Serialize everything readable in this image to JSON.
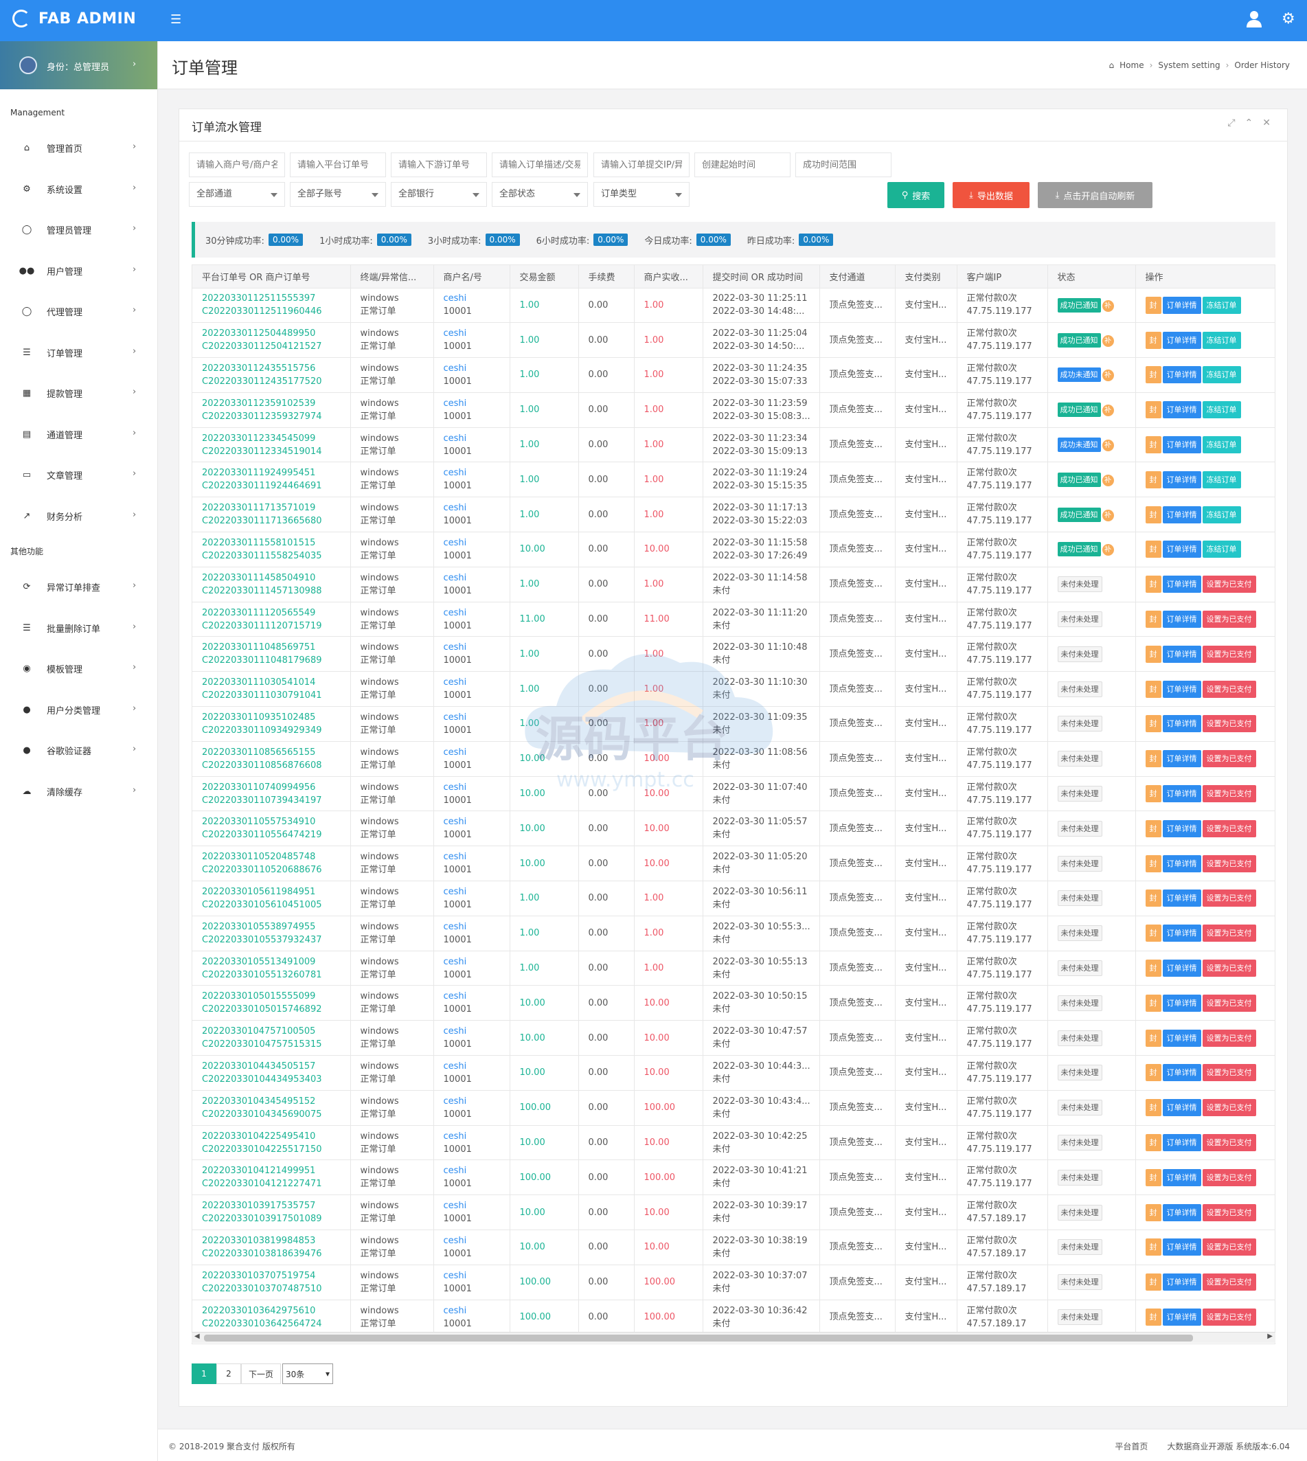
{
  "app": {
    "brand": "FAB ADMIN",
    "profile": "身份：总管理员"
  },
  "sidebar": {
    "section1": "Management",
    "section2": "其他功能",
    "items": [
      {
        "label": "管理首页",
        "icon": "home-icon"
      },
      {
        "label": "系统设置",
        "icon": "gears-icon"
      },
      {
        "label": "管理员管理",
        "icon": "user-circle-icon"
      },
      {
        "label": "用户管理",
        "icon": "users-icon"
      },
      {
        "label": "代理管理",
        "icon": "user-circle-icon"
      },
      {
        "label": "订单管理",
        "icon": "list-icon"
      },
      {
        "label": "提款管理",
        "icon": "lock-icon"
      },
      {
        "label": "通道管理",
        "icon": "bank-icon"
      },
      {
        "label": "文章管理",
        "icon": "book-icon"
      },
      {
        "label": "财务分析",
        "icon": "line-chart-icon"
      }
    ],
    "items2": [
      {
        "label": "异常订单排查",
        "icon": "refresh-icon"
      },
      {
        "label": "批量删除订单",
        "icon": "list-icon"
      },
      {
        "label": "模板管理",
        "icon": "apple-icon"
      },
      {
        "label": "用户分类管理",
        "icon": "wechat-icon"
      },
      {
        "label": "谷歌验证器",
        "icon": "user-icon"
      },
      {
        "label": "清除缓存",
        "icon": "cloud-icon"
      }
    ]
  },
  "header": {
    "title": "订单管理",
    "breadcrumb": [
      "Home",
      "System setting",
      "Order History"
    ]
  },
  "card": {
    "title": "订单流水管理"
  },
  "filters": {
    "row1": [
      "请输入商户号/商户名",
      "请输入平台订单号",
      "请输入下游订单号",
      "请输入订单描述/交易金额",
      "请输入订单提交IP/异常回调IP",
      "创建起始时间",
      "成功时间范围"
    ],
    "row2": [
      "全部通道",
      "全部子账号",
      "全部银行",
      "全部状态",
      "订单类型"
    ],
    "search": "搜索",
    "export": "导出数据",
    "refresh": "点击开启自动刷新"
  },
  "stats": [
    {
      "label": "30分钟成功率:",
      "value": "0.00%"
    },
    {
      "label": "1小时成功率:",
      "value": "0.00%"
    },
    {
      "label": "3小时成功率:",
      "value": "0.00%"
    },
    {
      "label": "6小时成功率:",
      "value": "0.00%"
    },
    {
      "label": "今日成功率:",
      "value": "0.00%"
    },
    {
      "label": "昨日成功率:",
      "value": "0.00%"
    }
  ],
  "table": {
    "columns": [
      "平台订单号 OR 商户订单号",
      "终端/异常信...",
      "商户名/号",
      "交易金额",
      "手续费",
      "商户实收...",
      "提交时间 OR 成功时间",
      "支付通道",
      "支付类别",
      "客户端IP",
      "状态",
      "操作"
    ],
    "terminal": "windows",
    "terminal_status": "正常订单",
    "merchant": "ceshi",
    "merchant_no": "10001",
    "fee": "0.00",
    "channel": "顶点免签支...",
    "category": "支付宝H...",
    "client": "正常付款0次",
    "status_unpaid": "未付未处理",
    "unpaid_time": "未付",
    "op_seal": "封",
    "op_detail": "订单详情",
    "op_freeze": "冻结订单",
    "op_setpaid": "设置为已支付",
    "repush": "补",
    "rows": [
      {
        "id": "20220330112511555397",
        "mid": "C20220330112511960446",
        "amt": "1.00",
        "real": "1.00",
        "t1": "2022-03-30 11:25:11",
        "t2": "2022-03-30 14:48:...",
        "ip": "47.75.119.177",
        "st": "成功已通知"
      },
      {
        "id": "20220330112504489950",
        "mid": "C20220330112504121527",
        "amt": "1.00",
        "real": "1.00",
        "t1": "2022-03-30 11:25:04",
        "t2": "2022-03-30 14:50:...",
        "ip": "47.75.119.177",
        "st": "成功已通知"
      },
      {
        "id": "20220330112435515756",
        "mid": "C20220330112435177520",
        "amt": "1.00",
        "real": "1.00",
        "t1": "2022-03-30 11:24:35",
        "t2": "2022-03-30 15:07:33",
        "ip": "47.75.119.177",
        "st": "成功未通知"
      },
      {
        "id": "20220330112359102539",
        "mid": "C20220330112359327974",
        "amt": "1.00",
        "real": "1.00",
        "t1": "2022-03-30 11:23:59",
        "t2": "2022-03-30 15:08:3...",
        "ip": "47.75.119.177",
        "st": "成功已通知"
      },
      {
        "id": "20220330112334545099",
        "mid": "C20220330112334519014",
        "amt": "1.00",
        "real": "1.00",
        "t1": "2022-03-30 11:23:34",
        "t2": "2022-03-30 15:09:13",
        "ip": "47.75.119.177",
        "st": "成功未通知"
      },
      {
        "id": "20220330111924995451",
        "mid": "C20220330111924464691",
        "amt": "1.00",
        "real": "1.00",
        "t1": "2022-03-30 11:19:24",
        "t2": "2022-03-30 15:15:35",
        "ip": "47.75.119.177",
        "st": "成功已通知"
      },
      {
        "id": "20220330111713571019",
        "mid": "C20220330111713665680",
        "amt": "1.00",
        "real": "1.00",
        "t1": "2022-03-30 11:17:13",
        "t2": "2022-03-30 15:22:03",
        "ip": "47.75.119.177",
        "st": "成功已通知"
      },
      {
        "id": "20220330111558101515",
        "mid": "C20220330111558254035",
        "amt": "10.00",
        "real": "10.00",
        "t1": "2022-03-30 11:15:58",
        "t2": "2022-03-30 17:26:49",
        "ip": "47.75.119.177",
        "st": "成功已通知"
      },
      {
        "id": "20220330111458504910",
        "mid": "C20220330111457130988",
        "amt": "1.00",
        "real": "1.00",
        "t1": "2022-03-30 11:14:58",
        "t2": "",
        "ip": "47.75.119.177",
        "st": ""
      },
      {
        "id": "20220330111120565549",
        "mid": "C20220330111120715719",
        "amt": "11.00",
        "real": "11.00",
        "t1": "2022-03-30 11:11:20",
        "t2": "",
        "ip": "47.75.119.177",
        "st": ""
      },
      {
        "id": "20220330111048569751",
        "mid": "C20220330111048179689",
        "amt": "1.00",
        "real": "1.00",
        "t1": "2022-03-30 11:10:48",
        "t2": "",
        "ip": "47.75.119.177",
        "st": ""
      },
      {
        "id": "20220330111030541014",
        "mid": "C20220330111030791041",
        "amt": "1.00",
        "real": "1.00",
        "t1": "2022-03-30 11:10:30",
        "t2": "",
        "ip": "47.75.119.177",
        "st": ""
      },
      {
        "id": "20220330110935102485",
        "mid": "C20220330110934929349",
        "amt": "1.00",
        "real": "1.00",
        "t1": "2022-03-30 11:09:35",
        "t2": "",
        "ip": "47.75.119.177",
        "st": ""
      },
      {
        "id": "20220330110856565155",
        "mid": "C20220330110856876608",
        "amt": "10.00",
        "real": "10.00",
        "t1": "2022-03-30 11:08:56",
        "t2": "",
        "ip": "47.75.119.177",
        "st": ""
      },
      {
        "id": "20220330110740994956",
        "mid": "C20220330110739434197",
        "amt": "10.00",
        "real": "10.00",
        "t1": "2022-03-30 11:07:40",
        "t2": "",
        "ip": "47.75.119.177",
        "st": ""
      },
      {
        "id": "20220330110557534910",
        "mid": "C20220330110556474219",
        "amt": "10.00",
        "real": "10.00",
        "t1": "2022-03-30 11:05:57",
        "t2": "",
        "ip": "47.75.119.177",
        "st": ""
      },
      {
        "id": "20220330110520485748",
        "mid": "C20220330110520688676",
        "amt": "10.00",
        "real": "10.00",
        "t1": "2022-03-30 11:05:20",
        "t2": "",
        "ip": "47.75.119.177",
        "st": ""
      },
      {
        "id": "20220330105611984951",
        "mid": "C20220330105610451005",
        "amt": "1.00",
        "real": "1.00",
        "t1": "2022-03-30 10:56:11",
        "t2": "",
        "ip": "47.75.119.177",
        "st": ""
      },
      {
        "id": "20220330105538974955",
        "mid": "C20220330105537932437",
        "amt": "1.00",
        "real": "1.00",
        "t1": "2022-03-30 10:55:3...",
        "t2": "",
        "ip": "47.75.119.177",
        "st": ""
      },
      {
        "id": "20220330105513491009",
        "mid": "C20220330105513260781",
        "amt": "1.00",
        "real": "1.00",
        "t1": "2022-03-30 10:55:13",
        "t2": "",
        "ip": "47.75.119.177",
        "st": ""
      },
      {
        "id": "20220330105015555099",
        "mid": "C20220330105015746892",
        "amt": "10.00",
        "real": "10.00",
        "t1": "2022-03-30 10:50:15",
        "t2": "",
        "ip": "47.75.119.177",
        "st": ""
      },
      {
        "id": "20220330104757100505",
        "mid": "C20220330104757515315",
        "amt": "10.00",
        "real": "10.00",
        "t1": "2022-03-30 10:47:57",
        "t2": "",
        "ip": "47.75.119.177",
        "st": ""
      },
      {
        "id": "20220330104434505157",
        "mid": "C20220330104434953403",
        "amt": "10.00",
        "real": "10.00",
        "t1": "2022-03-30 10:44:3...",
        "t2": "",
        "ip": "47.75.119.177",
        "st": ""
      },
      {
        "id": "20220330104345495152",
        "mid": "C20220330104345690075",
        "amt": "100.00",
        "real": "100.00",
        "t1": "2022-03-30 10:43:4...",
        "t2": "",
        "ip": "47.75.119.177",
        "st": ""
      },
      {
        "id": "20220330104225495410",
        "mid": "C20220330104225517150",
        "amt": "10.00",
        "real": "10.00",
        "t1": "2022-03-30 10:42:25",
        "t2": "",
        "ip": "47.75.119.177",
        "st": ""
      },
      {
        "id": "20220330104121499951",
        "mid": "C20220330104121227471",
        "amt": "100.00",
        "real": "100.00",
        "t1": "2022-03-30 10:41:21",
        "t2": "",
        "ip": "47.75.119.177",
        "st": ""
      },
      {
        "id": "20220330103917535757",
        "mid": "C20220330103917501089",
        "amt": "10.00",
        "real": "10.00",
        "t1": "2022-03-30 10:39:17",
        "t2": "",
        "ip": "47.57.189.17",
        "st": ""
      },
      {
        "id": "20220330103819984853",
        "mid": "C20220330103818639476",
        "amt": "10.00",
        "real": "10.00",
        "t1": "2022-03-30 10:38:19",
        "t2": "",
        "ip": "47.57.189.17",
        "st": ""
      },
      {
        "id": "20220330103707519754",
        "mid": "C20220330103707487510",
        "amt": "100.00",
        "real": "100.00",
        "t1": "2022-03-30 10:37:07",
        "t2": "",
        "ip": "47.57.189.17",
        "st": ""
      },
      {
        "id": "20220330103642975610",
        "mid": "C20220330103642564724",
        "amt": "100.00",
        "real": "100.00",
        "t1": "2022-03-30 10:36:42",
        "t2": "",
        "ip": "47.57.189.17",
        "st": ""
      }
    ]
  },
  "pagination": {
    "pages": [
      "1",
      "2"
    ],
    "next": "下一页",
    "size": "30条"
  },
  "footer": {
    "copyright": "© 2018-2019 聚合支付 版权所有",
    "home": "平台首页",
    "version": "大数据商业开源版 系统版本:6.04"
  },
  "watermark": {
    "title": "源码平台",
    "url": "www.ympt.cc"
  },
  "colors": {
    "primary": "#2d8cf0",
    "success": "#1ab394",
    "danger": "#ed5565",
    "warning": "#f8ac59",
    "info": "#23c6c8",
    "gray": "#9e9e9e",
    "export": "#f0543e"
  }
}
